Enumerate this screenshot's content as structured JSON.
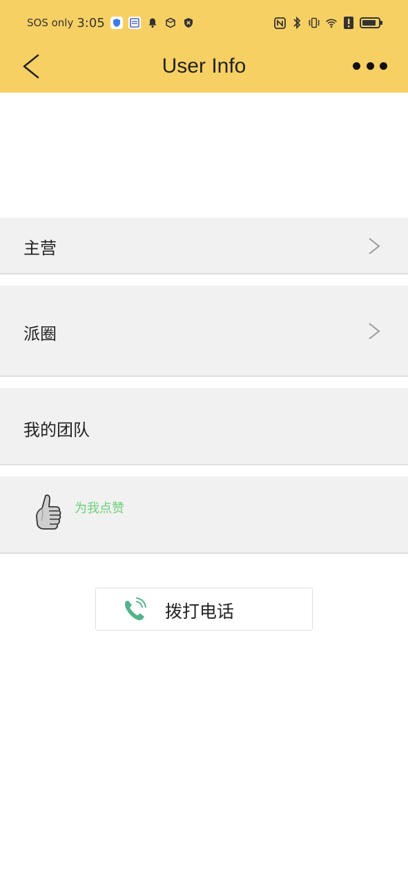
{
  "status_bar": {
    "carrier": "SOS only",
    "time": "3:05"
  },
  "nav": {
    "title": "User Info"
  },
  "rows": [
    {
      "label": "主营"
    },
    {
      "label": "派圈"
    },
    {
      "label": "我的团队"
    }
  ],
  "like": {
    "label": "为我点赞"
  },
  "call": {
    "label": "拨打电话"
  },
  "colors": {
    "header_bg": "#f7d064",
    "like_text": "#6ccf7a",
    "phone_icon": "#54b38a",
    "row_bg": "#f1f1f1"
  }
}
